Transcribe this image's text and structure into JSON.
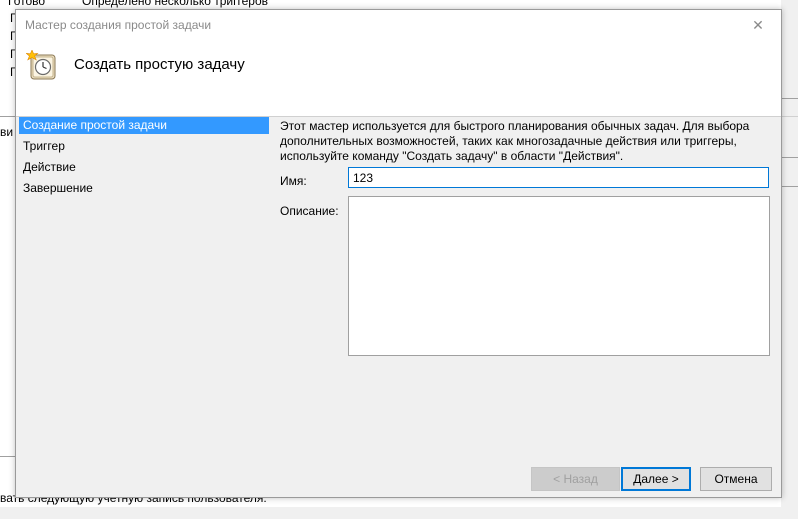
{
  "background": {
    "top_row": [
      "Готово",
      "Определено несколько триггеров"
    ],
    "side_letters": [
      "Г",
      "Г",
      "Г",
      "Г"
    ],
    "left_fragment": "ви",
    "bottom_text": "вать следующую учетную запись пользователя:"
  },
  "dialog": {
    "title": "Мастер создания простой задачи",
    "header_title": "Создать простую задачу",
    "steps": [
      {
        "label": "Создание простой задачи",
        "active": true
      },
      {
        "label": "Триггер",
        "active": false
      },
      {
        "label": "Действие",
        "active": false
      },
      {
        "label": "Завершение",
        "active": false
      }
    ],
    "description": "Этот мастер используется для быстрого планирования обычных задач.  Для выбора дополнительных возможностей, таких как многозадачные действия или триггеры, используйте команду \"Создать задачу\" в области \"Действия\".",
    "name_label": "Имя:",
    "name_value": "123",
    "description_label": "Описание:",
    "description_value": "",
    "buttons": {
      "back": "< Назад",
      "next": "Далее >",
      "cancel": "Отмена"
    }
  },
  "icons": {
    "close": "close-icon",
    "header": "scheduler-clock-icon"
  }
}
